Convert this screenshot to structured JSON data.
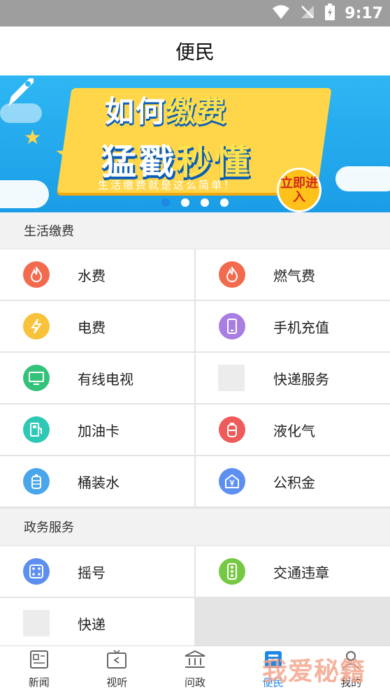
{
  "status_bar": {
    "time": "9:17"
  },
  "header": {
    "title": "便民"
  },
  "banner": {
    "line1_a": "如何",
    "line1_b": "缴费",
    "line2_a": "猛戳",
    "line2_b": "秒懂",
    "subtitle": "生活缴费就是这么简单！",
    "enter_label": "立即进入",
    "slide_index": 1,
    "slide_count": 4
  },
  "sections": [
    {
      "title": "生活缴费"
    },
    {
      "title": "政务服务"
    }
  ],
  "life_items": [
    {
      "label": "水费",
      "icon": "flame-icon",
      "color": "#f36b4f"
    },
    {
      "label": "燃气费",
      "icon": "flame-icon",
      "color": "#f36b4f"
    },
    {
      "label": "电费",
      "icon": "lightning-icon",
      "color": "#f8c23a"
    },
    {
      "label": "手机充值",
      "icon": "phone-icon",
      "color": "#a97ee3"
    },
    {
      "label": "有线电视",
      "icon": "tv-icon",
      "color": "#33c27a"
    },
    {
      "label": "快递服务",
      "icon": "placeholder-icon",
      "color": "#ececec"
    },
    {
      "label": "加油卡",
      "icon": "fuel-icon",
      "color": "#2dc9b4"
    },
    {
      "label": "液化气",
      "icon": "gas-tank-icon",
      "color": "#ef5b5b"
    },
    {
      "label": "桶装水",
      "icon": "water-bottle-icon",
      "color": "#4aa6ea"
    },
    {
      "label": "公积金",
      "icon": "yuan-house-icon",
      "color": "#5d8ff0"
    }
  ],
  "gov_items": [
    {
      "label": "摇号",
      "icon": "dice-icon",
      "color": "#5d8ff0"
    },
    {
      "label": "交通违章",
      "icon": "traffic-light-icon",
      "color": "#76c944"
    },
    {
      "label": "快递",
      "icon": "placeholder-icon",
      "color": "#ececec"
    }
  ],
  "tabs": [
    {
      "label": "新闻",
      "icon": "news-icon"
    },
    {
      "label": "视听",
      "icon": "video-icon"
    },
    {
      "label": "问政",
      "icon": "government-icon"
    },
    {
      "label": "便民",
      "icon": "service-icon",
      "active": true
    },
    {
      "label": "我的",
      "icon": "user-icon"
    }
  ],
  "watermark": "我爱秘籍",
  "colors": {
    "accent": "#1e88e5",
    "status_bar": "#9e9e9e"
  }
}
